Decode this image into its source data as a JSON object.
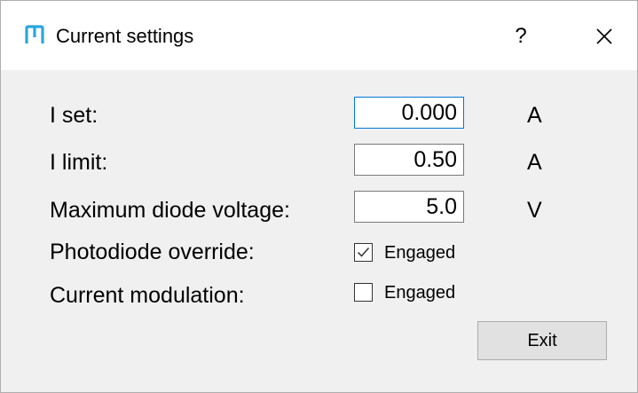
{
  "window": {
    "title": "Current settings",
    "help_label": "?",
    "icons": {
      "app": "m-logo-icon",
      "close": "close-icon"
    },
    "accent_color": "#2aa6df"
  },
  "settings": {
    "i_set": {
      "label": "I set:",
      "value": "0.000",
      "unit": "A"
    },
    "i_limit": {
      "label": "I limit:",
      "value": "0.50",
      "unit": "A"
    },
    "max_diode_voltage": {
      "label": "Maximum diode voltage:",
      "value": "5.0",
      "unit": "V"
    },
    "photodiode_override": {
      "label": "Photodiode override:",
      "checkbox_label": "Engaged",
      "checked": true
    },
    "current_modulation": {
      "label": "Current modulation:",
      "checkbox_label": "Engaged",
      "checked": false
    }
  },
  "buttons": {
    "exit_label": "Exit"
  }
}
